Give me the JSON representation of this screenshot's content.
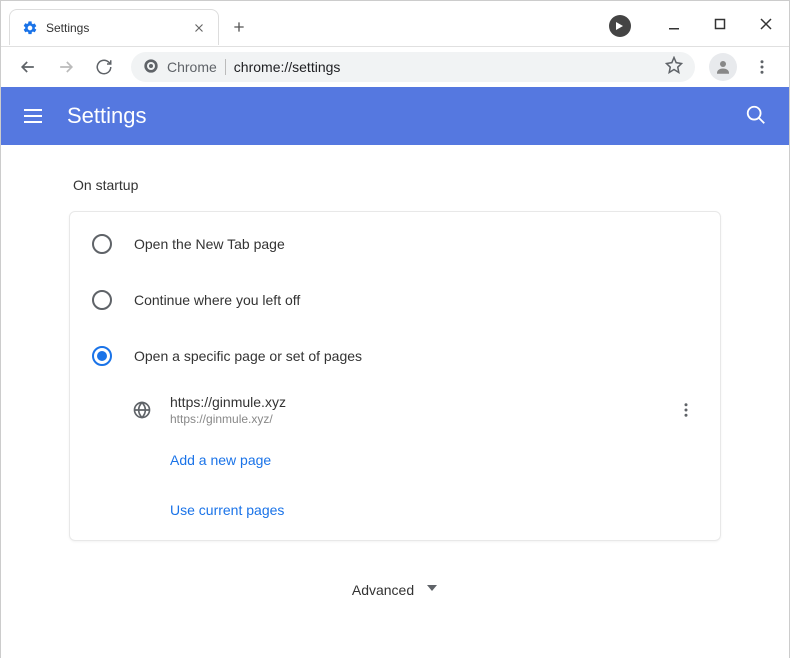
{
  "window": {
    "tab_title": "Settings"
  },
  "omnibox": {
    "product": "Chrome",
    "url": "chrome://settings"
  },
  "appbar": {
    "title": "Settings"
  },
  "startup": {
    "heading": "On startup",
    "options": [
      {
        "label": "Open the New Tab page",
        "selected": false
      },
      {
        "label": "Continue where you left off",
        "selected": false
      },
      {
        "label": "Open a specific page or set of pages",
        "selected": true
      }
    ],
    "pages": [
      {
        "title": "https://ginmule.xyz",
        "url": "https://ginmule.xyz/"
      }
    ],
    "add_page_label": "Add a new page",
    "use_current_label": "Use current pages"
  },
  "advanced_label": "Advanced"
}
